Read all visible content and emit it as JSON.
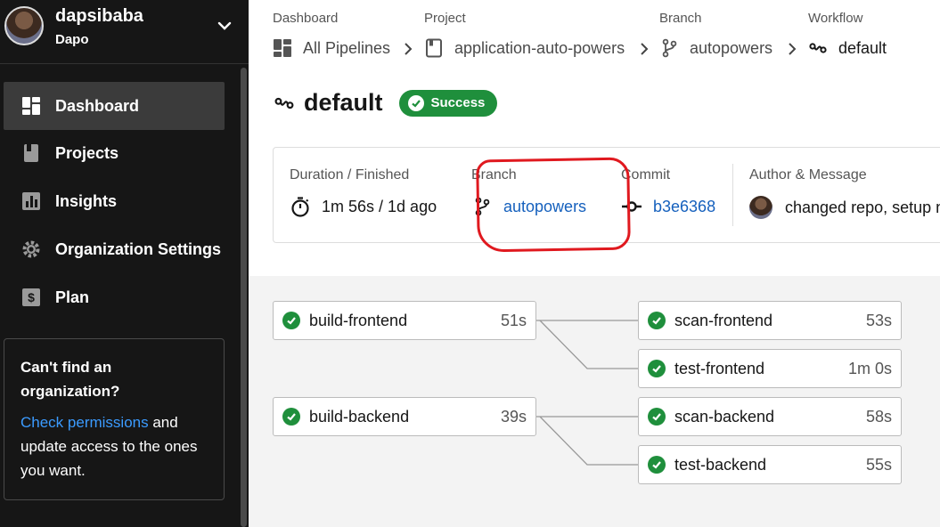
{
  "user": {
    "name": "dapsibaba",
    "org": "Dapo"
  },
  "nav": [
    {
      "label": "Dashboard",
      "icon": "dashboard-icon",
      "active": true
    },
    {
      "label": "Projects",
      "icon": "projects-icon"
    },
    {
      "label": "Insights",
      "icon": "insights-icon"
    },
    {
      "label": "Organization Settings",
      "icon": "gear-icon"
    },
    {
      "label": "Plan",
      "icon": "plan-icon"
    }
  ],
  "org_help": {
    "title": "Can't find an organization?",
    "link": "Check permissions",
    "rest": " and update access to the ones you want."
  },
  "breadcrumb": [
    {
      "head": "Dashboard",
      "value": "All Pipelines"
    },
    {
      "head": "Project",
      "value": "application-auto-powers"
    },
    {
      "head": "Branch",
      "value": "autopowers"
    },
    {
      "head": "Workflow",
      "value": "default"
    }
  ],
  "workflow": {
    "title": "default",
    "status": "Success"
  },
  "info": {
    "duration_head": "Duration / Finished",
    "duration_value": "1m 56s / 1d ago",
    "branch_head": "Branch",
    "branch_value": "autopowers",
    "commit_head": "Commit",
    "commit_value": "b3e6368",
    "author_head": "Author & Message",
    "author_value": "changed repo, setup n"
  },
  "jobs": [
    {
      "name": "build-frontend",
      "time": "51s"
    },
    {
      "name": "scan-frontend",
      "time": "53s"
    },
    {
      "name": "test-frontend",
      "time": "1m 0s"
    },
    {
      "name": "build-backend",
      "time": "39s"
    },
    {
      "name": "scan-backend",
      "time": "58s"
    },
    {
      "name": "test-backend",
      "time": "55s"
    }
  ],
  "colors": {
    "success": "#1f8f3c",
    "link": "#1560bd",
    "annotation": "#e0191f"
  }
}
